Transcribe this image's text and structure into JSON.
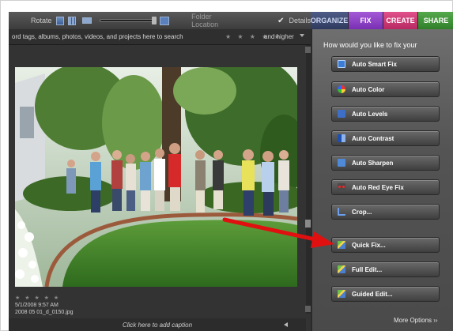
{
  "toolbar": {
    "rotate_label": "Rotate",
    "folder_location_label": "Folder Location",
    "details_label": "Details",
    "details_checked": true
  },
  "tabs": [
    {
      "label": "ORGANIZE",
      "active": false
    },
    {
      "label": "FIX",
      "active": true
    },
    {
      "label": "CREATE",
      "active": false
    },
    {
      "label": "SHARE",
      "active": false
    }
  ],
  "search": {
    "hint": "ord tags, albums, photos, videos, and projects here to search",
    "rating_stars": "★ ★ ★ ★ ★",
    "rating_suffix": "and higher"
  },
  "photo": {
    "rating_stars": "★ ★ ★ ★ ★",
    "date": "5/1/2008 9:57 AM",
    "filename": "2008 05 01_d_0150.jpg",
    "caption_placeholder": "Click here to add caption"
  },
  "fix_panel": {
    "title": "How would you like to fix your",
    "buttons": [
      {
        "label": "Auto Smart Fix",
        "icon": "smart-fix-icon"
      },
      {
        "label": "Auto Color",
        "icon": "color-wheel-icon"
      },
      {
        "label": "Auto Levels",
        "icon": "levels-icon"
      },
      {
        "label": "Auto Contrast",
        "icon": "contrast-icon"
      },
      {
        "label": "Auto Sharpen",
        "icon": "sharpen-icon"
      },
      {
        "label": "Auto Red Eye Fix",
        "icon": "red-eye-icon"
      },
      {
        "label": "Crop...",
        "icon": "crop-icon"
      },
      {
        "label": "Quick Fix...",
        "icon": "quick-fix-icon"
      },
      {
        "label": "Full Edit...",
        "icon": "full-edit-icon"
      },
      {
        "label": "Guided Edit...",
        "icon": "guided-edit-icon"
      }
    ],
    "more_options": "More Options"
  },
  "colors": {
    "fix_tab": "#8e44c8",
    "create_tab": "#c83a72",
    "share_tab": "#3d8f36",
    "organize_tab": "#3a4670",
    "annotation_arrow": "#e01010"
  }
}
